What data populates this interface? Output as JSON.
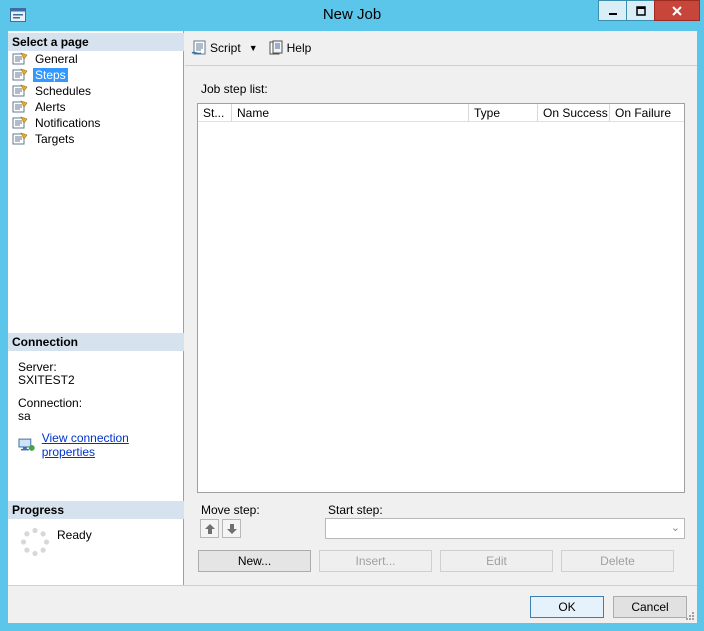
{
  "window": {
    "title": "New Job"
  },
  "left": {
    "select_page_header": "Select a page",
    "pages": [
      {
        "label": "General",
        "selected": false
      },
      {
        "label": "Steps",
        "selected": true
      },
      {
        "label": "Schedules",
        "selected": false
      },
      {
        "label": "Alerts",
        "selected": false
      },
      {
        "label": "Notifications",
        "selected": false
      },
      {
        "label": "Targets",
        "selected": false
      }
    ],
    "connection_header": "Connection",
    "server_label": "Server:",
    "server_value": "SXITEST2",
    "connection_label": "Connection:",
    "connection_value": "sa",
    "view_connection_link": "View connection properties",
    "progress_header": "Progress",
    "progress_status": "Ready"
  },
  "toolbar": {
    "script_label": "Script",
    "help_label": "Help"
  },
  "main": {
    "job_step_list_label": "Job step list:",
    "columns": [
      "St...",
      "Name",
      "Type",
      "On Success",
      "On Failure"
    ],
    "move_step_label": "Move step:",
    "start_step_label": "Start step:",
    "start_step_value": "",
    "buttons": {
      "new": "New...",
      "insert": "Insert...",
      "edit": "Edit",
      "delete": "Delete"
    }
  },
  "footer": {
    "ok_label": "OK",
    "cancel_label": "Cancel"
  }
}
